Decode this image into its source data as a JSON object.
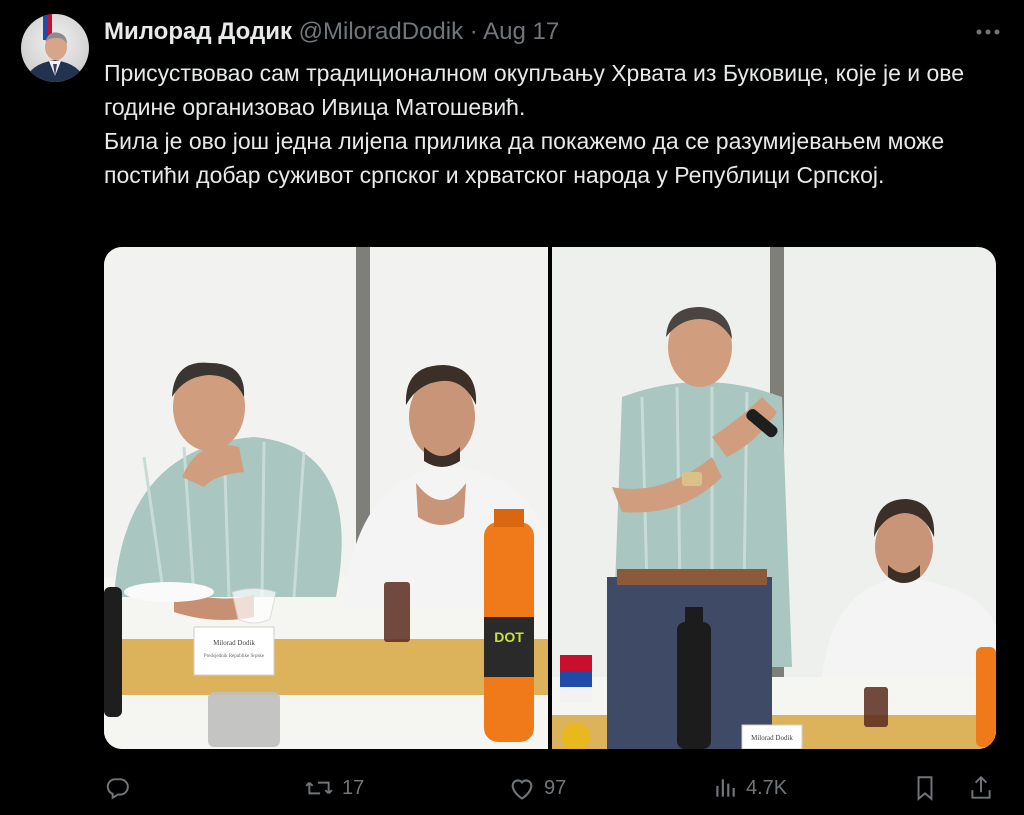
{
  "author": {
    "name": "Милорад Додик",
    "handle": "@MiloradDodik",
    "separator": "·",
    "date": "Aug 17"
  },
  "tweet": {
    "paragraphs": [
      "Присуствовао сам традиционалном окупљању Хрвата из Буковице, које је и ове године организовао Ивица Матошевић.",
      "Била је ово још једна лијепа прилика да покажемо да се разумијевањем може постићи добар суживот српског и хрватског народа у Републици Српској."
    ]
  },
  "media": {
    "nameplate_line1": "Milorad Dodik",
    "nameplate_line2": "Predsjednik Republike Srpske",
    "nameplate_right": "Milorad Dodik"
  },
  "actions": {
    "reply_count": "",
    "retweet_count": "17",
    "like_count": "97",
    "view_count": "4.7K"
  },
  "colors": {
    "background": "#000000",
    "text": "#e7e9ea",
    "muted": "#71767b"
  }
}
